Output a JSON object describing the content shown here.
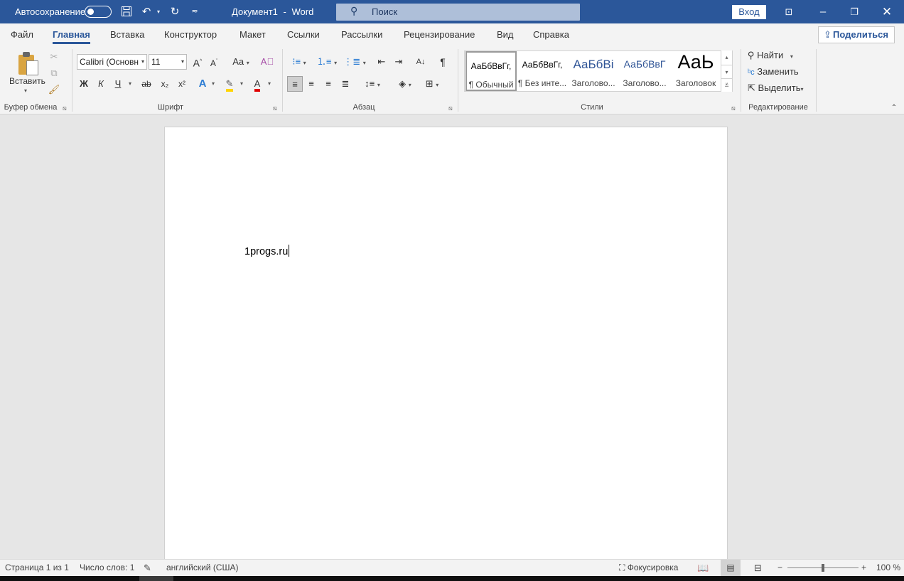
{
  "titlebar": {
    "autosave_label": "Автосохранение",
    "doc_title": "Документ1",
    "separator": "-",
    "app_name": "Word",
    "search_placeholder": "Поиск",
    "signin_label": "Вход"
  },
  "tabs": [
    "Файл",
    "Главная",
    "Вставка",
    "Конструктор",
    "Макет",
    "Ссылки",
    "Рассылки",
    "Рецензирование",
    "Вид",
    "Справка"
  ],
  "active_tab": "Главная",
  "share_label": "Поделиться",
  "ribbon": {
    "clipboard": {
      "group_label": "Буфер обмена",
      "paste_label": "Вставить"
    },
    "font": {
      "group_label": "Шрифт",
      "font_name": "Calibri (Основн",
      "font_size": "11",
      "bold": "Ж",
      "italic": "К",
      "underline": "Ч",
      "strike": "ab",
      "sub": "x₂",
      "sup": "x²",
      "grow": "A",
      "shrink": "A",
      "case": "Aa",
      "effects": "A",
      "color": "A"
    },
    "paragraph": {
      "group_label": "Абзац"
    },
    "styles": {
      "group_label": "Стили",
      "items": [
        {
          "preview": "АаБбВвГг,",
          "name": "¶ Обычный"
        },
        {
          "preview": "АаБбВвГг,",
          "name": "¶ Без инте..."
        },
        {
          "preview": "АаБбВі",
          "name": "Заголово..."
        },
        {
          "preview": "АаБбВвГ",
          "name": "Заголово..."
        },
        {
          "preview": "АаЬ",
          "name": "Заголовок"
        }
      ]
    },
    "editing": {
      "group_label": "Редактирование",
      "find": "Найти",
      "replace": "Заменить",
      "select": "Выделить"
    }
  },
  "document": {
    "text": "1progs.ru"
  },
  "status": {
    "page": "Страница 1 из 1",
    "words": "Число слов: 1",
    "language": "английский (США)",
    "focus": "Фокусировка",
    "zoom": "100 %",
    "zoom_percent": 100
  },
  "colors": {
    "accent": "#2b579a",
    "highlight": "#ffd400",
    "font_color": "#e00000"
  }
}
